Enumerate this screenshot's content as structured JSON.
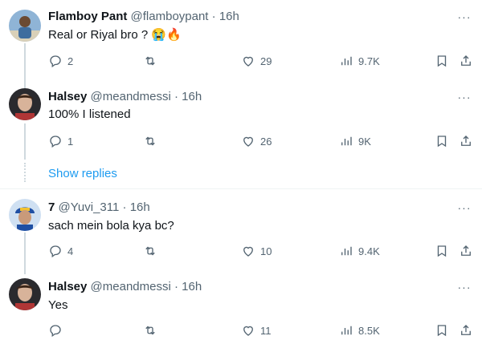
{
  "tweets": [
    {
      "name": "Flamboy Pant",
      "handle": "@flamboypant",
      "sep": "·",
      "time": "16h",
      "text": "Real or Riyal bro ? 😭🔥",
      "replies": "2",
      "retweets": "",
      "likes": "29",
      "views": "9.7K",
      "avatar_color": "#7fa6c9"
    },
    {
      "name": "Halsey",
      "handle": "@meandmessi",
      "sep": "·",
      "time": "16h",
      "text": "100% I listened",
      "replies": "1",
      "retweets": "",
      "likes": "26",
      "views": "9K",
      "avatar_color": "#5a2f2a"
    },
    {
      "name": "7",
      "handle": "@Yuvi_311",
      "sep": "·",
      "time": "16h",
      "text": "sach mein bola kya bc?",
      "replies": "4",
      "retweets": "",
      "likes": "10",
      "views": "9.4K",
      "avatar_color": "#3b6fb6"
    },
    {
      "name": "Halsey",
      "handle": "@meandmessi",
      "sep": "·",
      "time": "16h",
      "text": "Yes",
      "replies": "",
      "retweets": "",
      "likes": "11",
      "views": "8.5K",
      "avatar_color": "#5a2f2a"
    }
  ],
  "show_replies": "Show replies",
  "more_label": "···",
  "colors": {
    "link": "#1d9bf0",
    "muted": "#536471",
    "text": "#0f1419",
    "line": "#cfd9de"
  }
}
